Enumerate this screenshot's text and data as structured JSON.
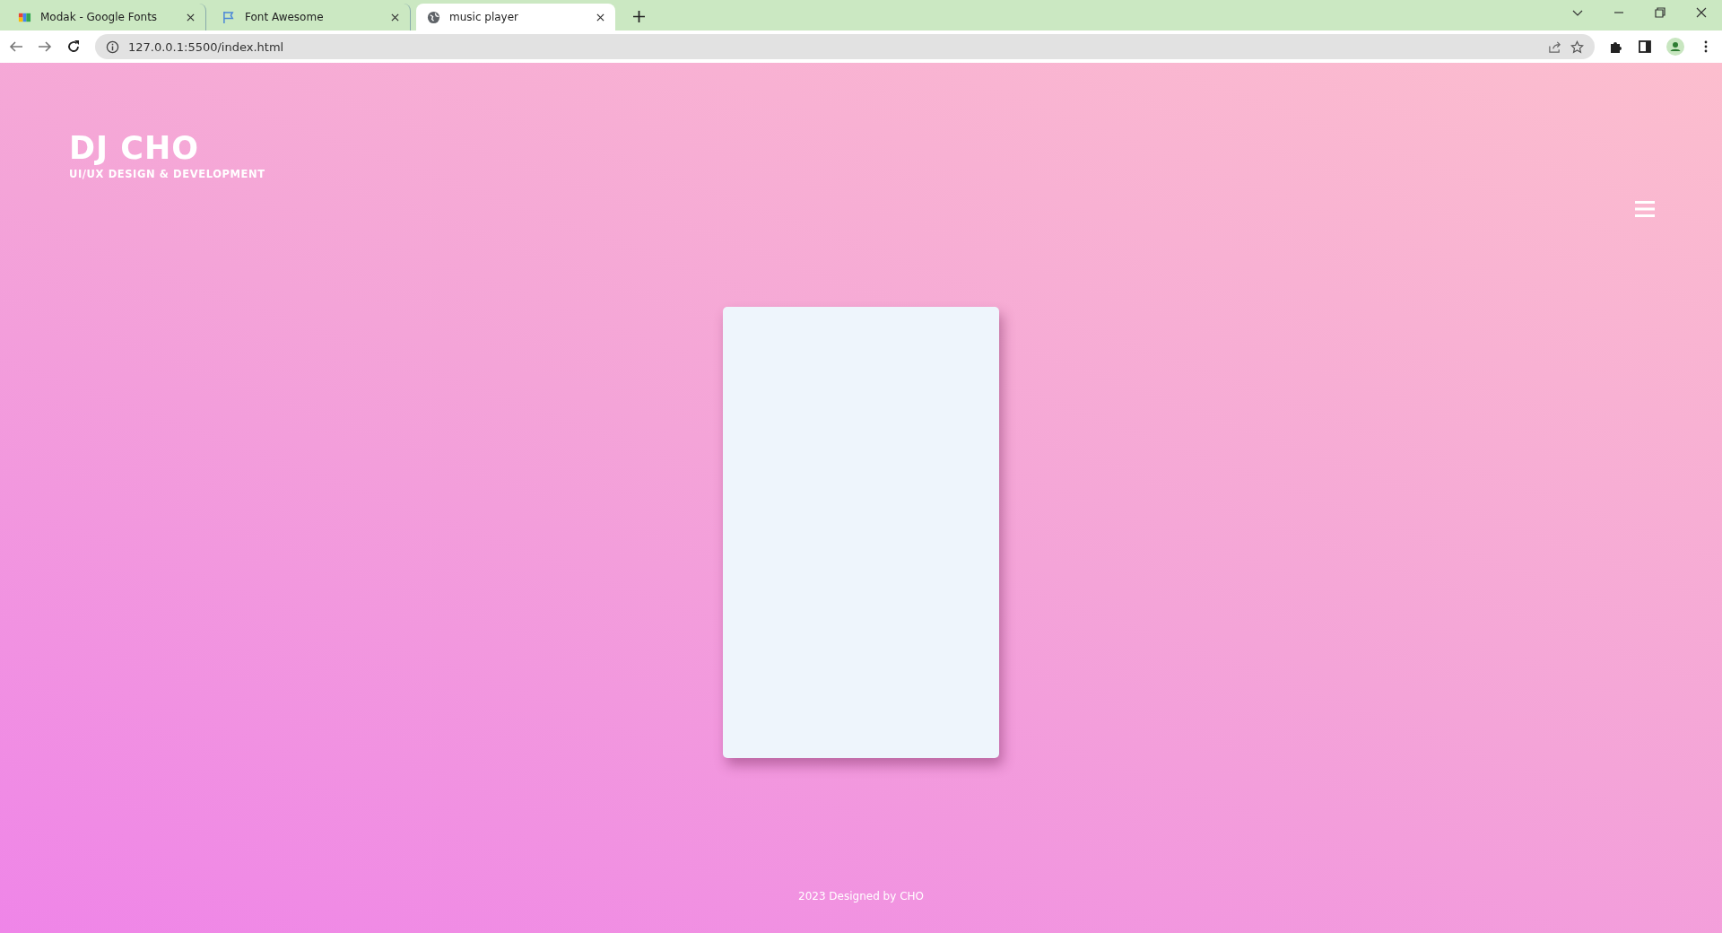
{
  "browser": {
    "tabs": [
      {
        "label": "Modak - Google Fonts",
        "selected": false,
        "kind": "blocks"
      },
      {
        "label": "Font Awesome",
        "selected": false,
        "kind": "flag"
      },
      {
        "label": "music player",
        "selected": true,
        "kind": "globe"
      }
    ],
    "address": "127.0.0.1:5500/index.html"
  },
  "header": {
    "title": "DJ CHO",
    "subtitle": "UI/UX DESIGN & DEVELOPMENT"
  },
  "footer": {
    "text": "2023 Designed by CHO"
  }
}
